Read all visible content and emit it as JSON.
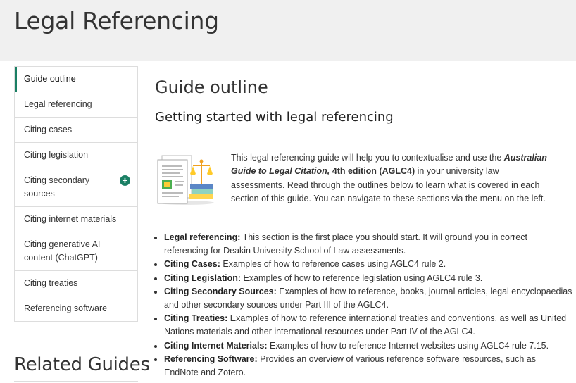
{
  "page_title": "Legal Referencing",
  "sidebar": {
    "items": [
      {
        "label": "Guide outline",
        "active": true
      },
      {
        "label": "Legal referencing"
      },
      {
        "label": "Citing cases"
      },
      {
        "label": "Citing legislation"
      },
      {
        "label": "Citing secondary sources",
        "expandable": true
      },
      {
        "label": "Citing internet materials"
      },
      {
        "label": "Citing generative AI content (ChatGPT)"
      },
      {
        "label": "Citing treaties"
      },
      {
        "label": "Referencing software"
      }
    ],
    "expand_symbol": "+"
  },
  "related_heading": "Related Guides",
  "main": {
    "heading": "Guide outline",
    "subheading": "Getting started with legal referencing",
    "intro": {
      "part1": "This legal referencing guide will help you to contextualise and use the ",
      "book_title": "Australian Guide to Legal Citation,",
      "edition": " 4th edition (AGLC4)",
      "part2": " in your university law assessments. Read through the outlines below to learn what is covered in each section of this guide. You can navigate to these sections via the menu on the left."
    },
    "bullets": [
      {
        "term": "Legal referencing:",
        "text": " This section is the first place you should start. It will ground you in correct referencing for Deakin University School of Law assessments."
      },
      {
        "term": "Citing Cases:",
        "text": " Examples of how to reference cases using AGLC4 rule 2."
      },
      {
        "term": "Citing Legislation:",
        "text": " Examples of how to reference legislation using AGLC4 rule 3."
      },
      {
        "term": "Citing Secondary Sources:",
        "text": " Examples of how to reference, books, journal articles, legal encyclopaedias and other secondary sources under Part III of the AGLC4."
      },
      {
        "term": "Citing Treaties:",
        "text": " Examples of how to reference international treaties and conventions, as well as United Nations materials and other international resources under Part IV of the AGLC4."
      },
      {
        "term": "Citing Internet Materials:",
        "text": " Examples of how to reference Internet websites using AGLC4 rule 7.15."
      },
      {
        "term": "Referencing Software:",
        "text": " Provides an overview of various reference software resources, such as EndNote and Zotero."
      }
    ]
  },
  "colors": {
    "accent": "#1a7f64",
    "banner": "#f0f0f0"
  }
}
